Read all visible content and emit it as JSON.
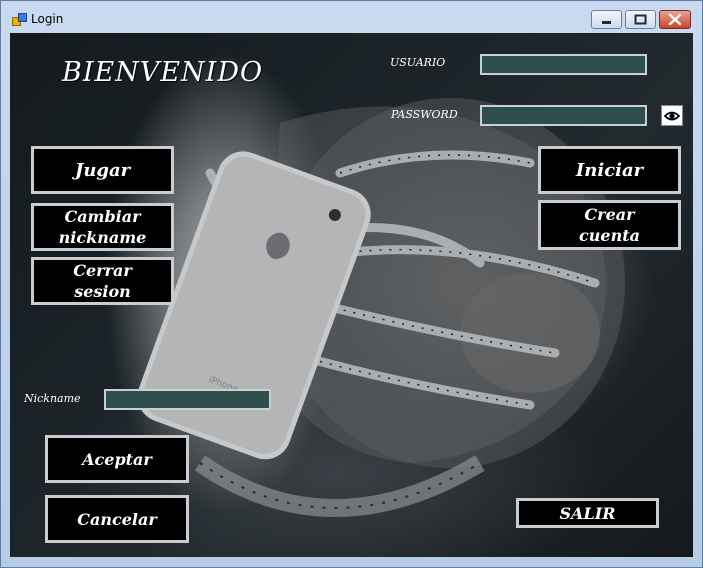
{
  "window": {
    "title": "Login"
  },
  "titlebar_buttons": {
    "minimize": "minimize-icon",
    "maximize": "maximize-icon",
    "close": "close-icon"
  },
  "heading": "BIENVENIDO",
  "usuario": {
    "label": "USUARIO",
    "value": ""
  },
  "password": {
    "label": "PASSWORD",
    "value": "",
    "toggle_icon": "eye-icon"
  },
  "left_buttons": {
    "jugar": "Jugar",
    "cambiar_line1": "Cambiar",
    "cambiar_line2": "nickname",
    "cerrar_line1": "Cerrar",
    "cerrar_line2": "sesion"
  },
  "right_buttons": {
    "iniciar": "Iniciar",
    "crear_line1": "Crear",
    "crear_line2": "cuenta"
  },
  "nickname": {
    "label": "Nickname",
    "value": ""
  },
  "bottom_buttons": {
    "aceptar": "Aceptar",
    "cancelar": "Cancelar",
    "salir": "SALIR"
  },
  "colors": {
    "textbox_fill": "#2f4f4f",
    "button_fill": "#000000",
    "button_border": "#c9cdd2",
    "title_bg": "#c9daf0"
  },
  "background_image": "man-with-alien-phone-facehugger"
}
